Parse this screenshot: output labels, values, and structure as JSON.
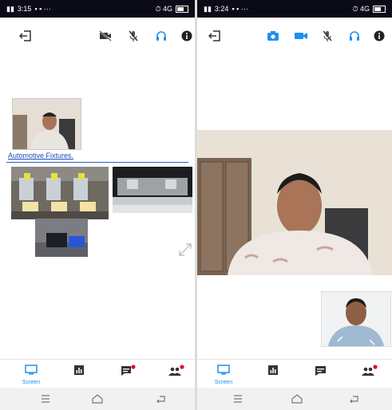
{
  "phone1": {
    "status": {
      "time": "3:15",
      "right": "⏱ 4G"
    },
    "slide": {
      "title": "Automotive Fixtures."
    },
    "nav": {
      "screen_label": "Screen"
    }
  },
  "phone2": {
    "status": {
      "time": "3:24",
      "right": "⏱ 4G"
    },
    "nav": {
      "screen_label": "Screen"
    }
  },
  "colors": {
    "accent": "#1e8ff0",
    "status_bar": "#0b0b17",
    "badge": "#e0102a"
  }
}
